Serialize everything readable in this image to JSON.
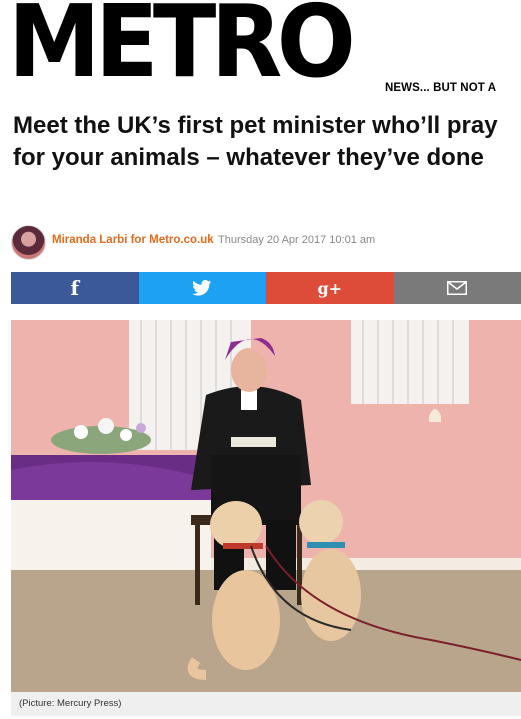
{
  "masthead": {
    "logo": "METRO",
    "tagline": "NEWS... BUT NOT A"
  },
  "article": {
    "headline": "Meet the UK’s first pet minister who’ll pray for your animals – whatever they’ve done",
    "author": "Miranda Larbi for Metro.co.uk",
    "timestamp": "Thursday 20 Apr 2017 10:01 am",
    "caption": "(Picture: Mercury Press)"
  },
  "share": {
    "facebook_label": "f",
    "google_label": "g+",
    "colors": {
      "facebook": "#3b5998",
      "twitter": "#1da1f2",
      "google": "#dd4b39",
      "email": "#7a7a7a"
    },
    "icons": [
      "facebook-icon",
      "twitter-icon",
      "google-plus-icon",
      "email-icon"
    ]
  },
  "colors": {
    "author": "#e36b1a",
    "headline": "#111111"
  }
}
